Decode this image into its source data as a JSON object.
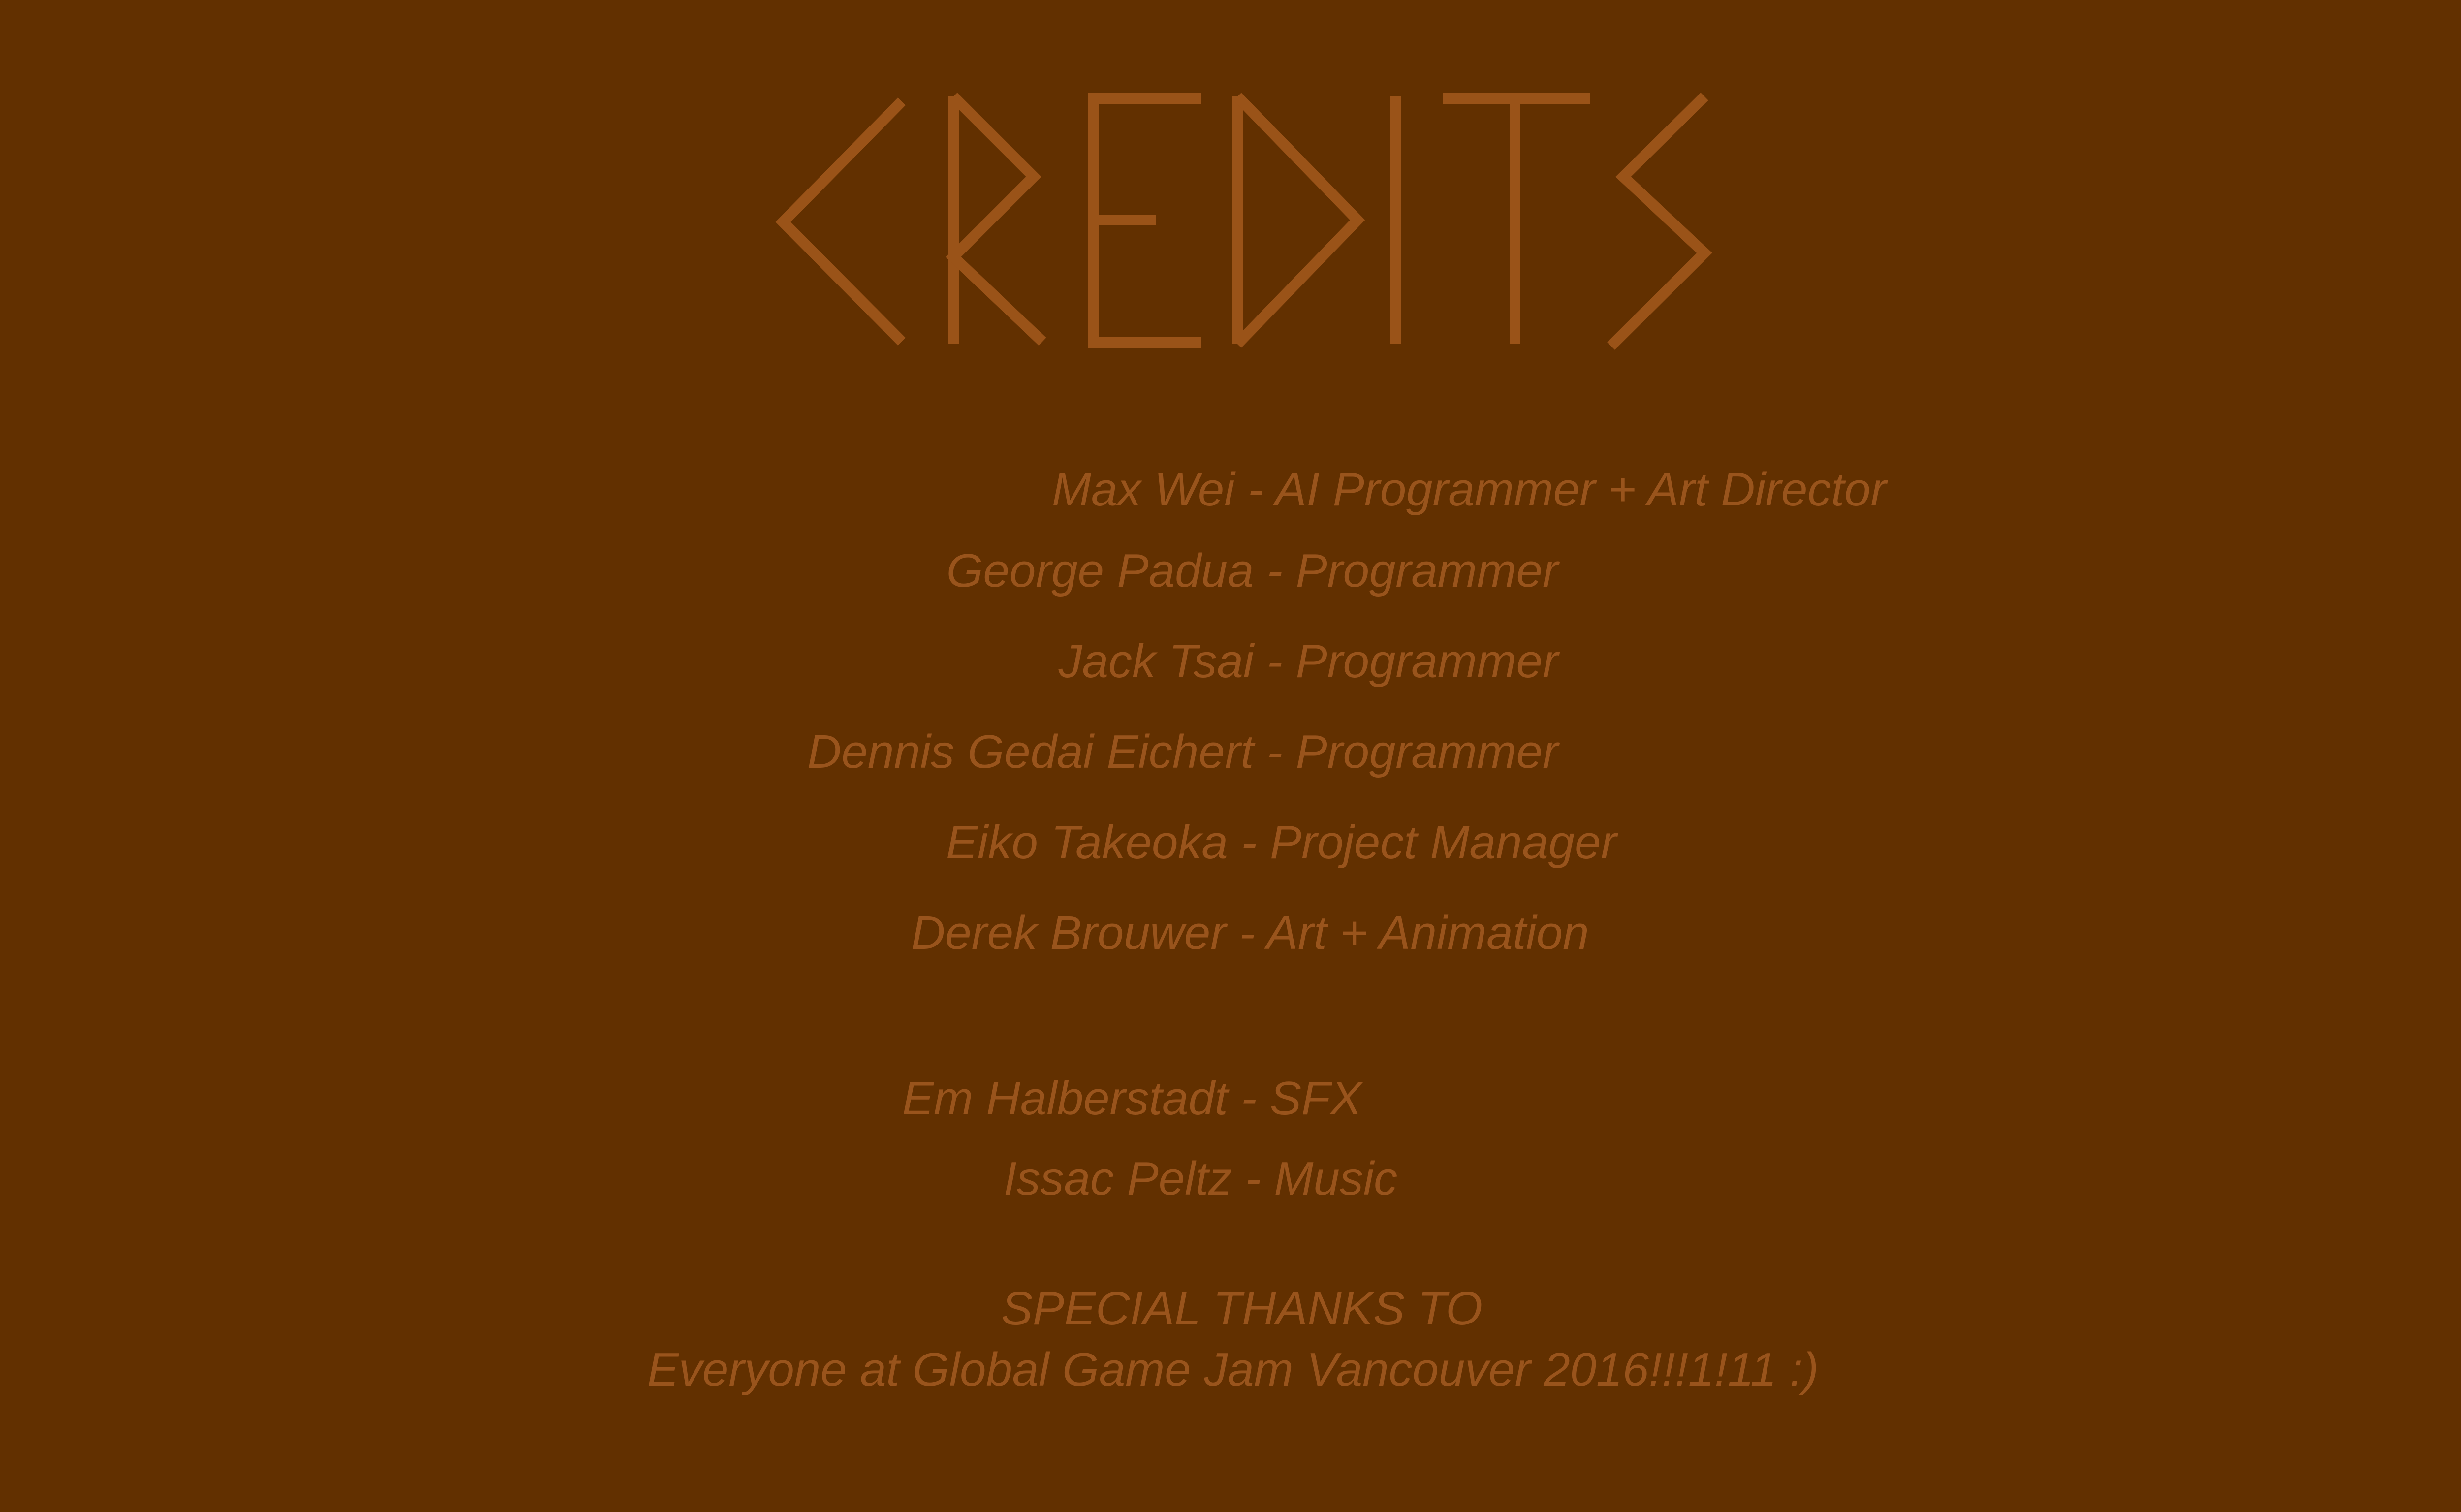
{
  "title": "CREDITS",
  "colors": {
    "background": "#623000",
    "text": "#99541c",
    "title_stroke": "#9a5318"
  },
  "credits": [
    "Max Wei - AI Programmer + Art Director",
    "George Padua - Programmer",
    "Jack Tsai - Programmer",
    "Dennis Gedai Eichert - Programmer",
    "Eiko Takeoka - Project Manager",
    "Derek Brouwer - Art + Animation",
    "Em Halberstadt - SFX",
    "Issac Peltz - Music"
  ],
  "special_thanks": {
    "heading": "SPECIAL THANKS TO",
    "message": "Everyone at Global Game Jam Vancouver 2016!!!1!11 :)"
  }
}
